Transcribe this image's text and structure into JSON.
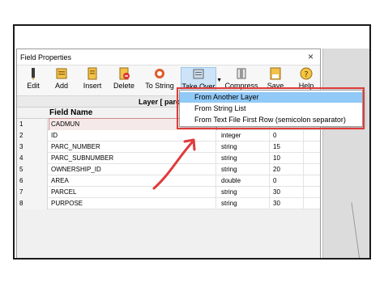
{
  "window": {
    "title": "Field Properties",
    "close_glyph": "×"
  },
  "toolbar": {
    "edit": "Edit",
    "add": "Add",
    "insert": "Insert",
    "delete": "Delete",
    "to_string": "To String",
    "take_over": "Take Over",
    "compress": "Compress",
    "save": "Save",
    "help": "Help"
  },
  "layer_bar": {
    "text": "Layer  [ parc"
  },
  "table": {
    "header": "Field Name",
    "rows": [
      {
        "num": "1",
        "name": "CADMUN",
        "type": "",
        "len": ""
      },
      {
        "num": "2",
        "name": "ID",
        "type": "integer",
        "len": "0"
      },
      {
        "num": "3",
        "name": "PARC_NUMBER",
        "type": "string",
        "len": "15"
      },
      {
        "num": "4",
        "name": "PARC_SUBNUMBER",
        "type": "string",
        "len": "10"
      },
      {
        "num": "5",
        "name": "OWNERSHIP_ID",
        "type": "string",
        "len": "20"
      },
      {
        "num": "6",
        "name": "AREA",
        "type": "double",
        "len": "0"
      },
      {
        "num": "7",
        "name": "PARCEL",
        "type": "string",
        "len": "30"
      },
      {
        "num": "8",
        "name": "PURPOSE",
        "type": "string",
        "len": "30"
      }
    ]
  },
  "dropdown": {
    "items": [
      "From Another Layer",
      "From String List",
      "From Text File First Row (semicolon separator)"
    ]
  },
  "colors": {
    "accent_red": "#e03a3a",
    "menu_highlight": "#91c9f7"
  }
}
